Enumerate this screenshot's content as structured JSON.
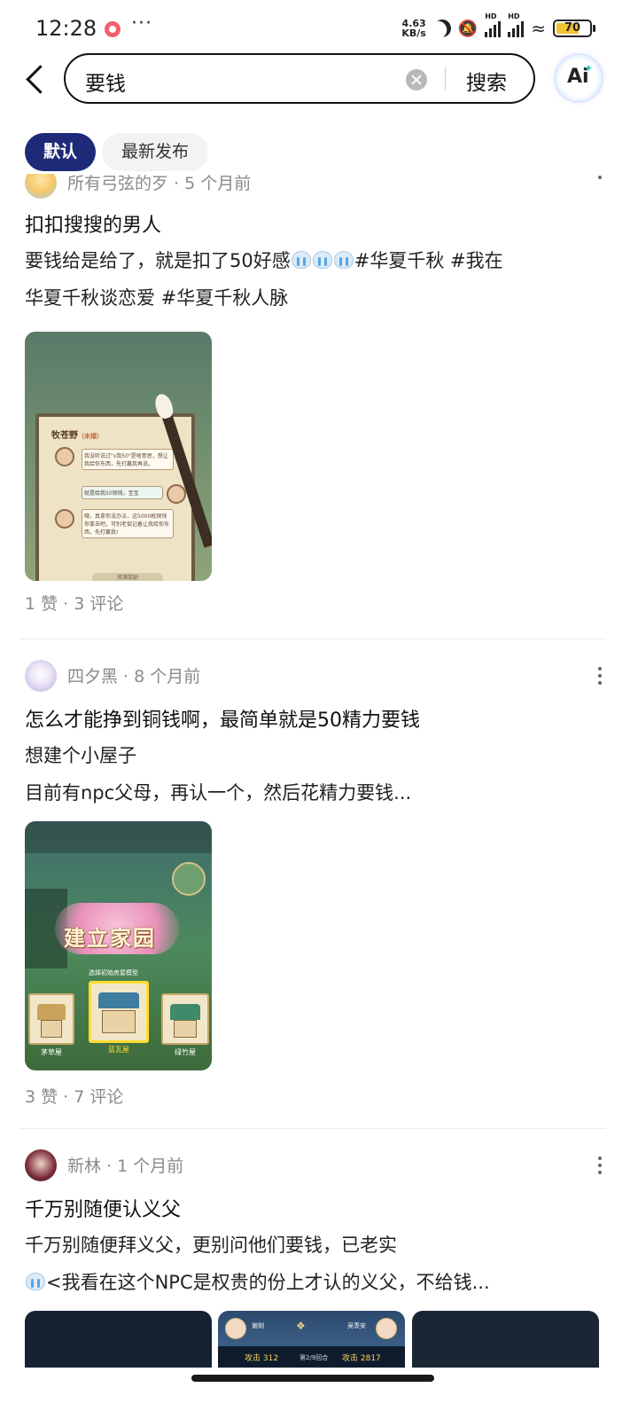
{
  "status_bar": {
    "time": "12:28",
    "more": "···",
    "net_speed_value": "4.63",
    "net_speed_unit": "KB/s",
    "signal_label": "HD",
    "battery": "70",
    "battery_level": 0.7
  },
  "search": {
    "query": "要钱",
    "button_label": "搜索",
    "ai_label": "Ai"
  },
  "filters": {
    "default": "默认",
    "latest": "最新发布"
  },
  "posts": [
    {
      "author_line": "所有弓弦的歹 · 5 个月前",
      "title": "扣扣搜搜的男人",
      "line1_text": "要钱给是给了，就是扣了50好感",
      "line1_tags": "#华夏千秋 #我在",
      "line2": "华夏千秋谈恋爱 #华夏千秋人脉",
      "thumb": {
        "name": "牧苍野",
        "name_tag": "（未婚）",
        "bubble1": "我没听说过\"v我50\"是啥意思，想让我给你东西，先打赢我再说。",
        "bubble2": "就是给我50铜钱，宝宝",
        "bubble3": "哦，真拿你没办法，这5000枚铜钱你拿去吧，可别老惦记着让我给你东西，先打赢我!",
        "button": "资源奖励"
      },
      "stats": "1 赞 · 3 评论"
    },
    {
      "author_line": "四夕黑 · 8 个月前",
      "title": "怎么才能挣到铜钱啊，最简单就是50精力要钱",
      "line1": "想建个小屋子",
      "line2": "目前有npc父母，再认一个，然后花精力要钱...",
      "thumb": {
        "banner": "建立家园",
        "subtitle": "选择初始房屋模型",
        "card1": "茅草屋",
        "card2": "蓝瓦屋",
        "card3": "绿竹屋"
      },
      "stats": "3 赞 · 7 评论"
    },
    {
      "author_line": "新林 · 1 个月前",
      "title": "千万别随便认义父",
      "line1": "千万别随便拜义父，更别问他们要钱，已老实",
      "line2": "<我看在这个NPC是权贵的份上才认的义父，不给钱...",
      "thumb": {
        "left_name": "谢刻",
        "right_name": "吴羡安",
        "left_score": "攻击 312",
        "round": "第2/9回合",
        "right_score": "攻击 2817"
      }
    }
  ]
}
